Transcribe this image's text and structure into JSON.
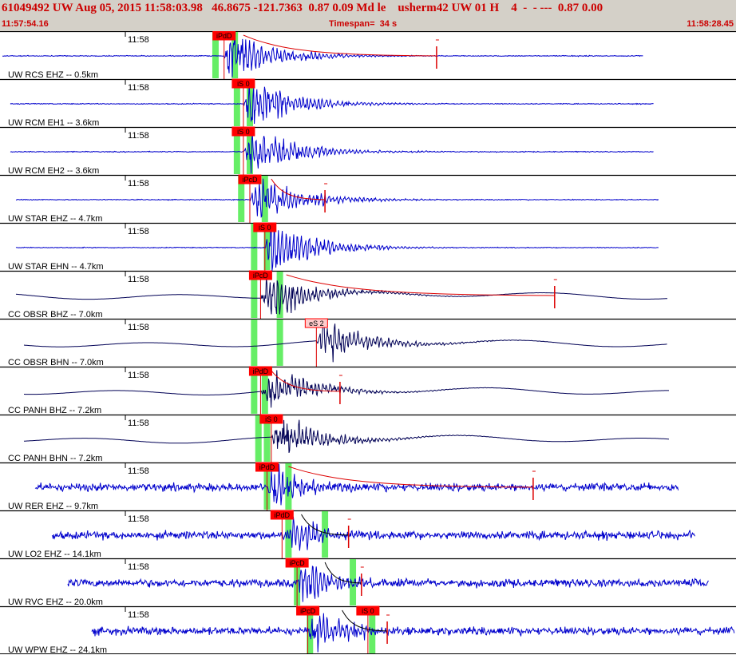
{
  "header": {
    "title": "61049492 UW Aug 05, 2015 11:58:03.98   46.8675 -121.7363  0.87 0.09 Md le    usherm42 UW 01 H    4  -  - ---  0.87 0.00",
    "start_time": "11:57:54.16",
    "timespan": "Timespan=  34 s",
    "end_time": "11:58:28.45"
  },
  "colors": {
    "trace": "#0000cc",
    "trace_dark": "#000055",
    "pick": "#dd0000",
    "pick_box": "#ff0000",
    "window": "#66ee66",
    "background": "#ffffff",
    "header_bg": "#d4d0c8",
    "header_text": "#cc0000"
  },
  "chart_data": {
    "type": "line",
    "title": "",
    "xlabel": "",
    "ylabel": "",
    "x_range": [
      "11:57:54.16",
      "11:58:28.45"
    ],
    "tick_label": "11:58",
    "series": [
      {
        "label": "UW RCS EHZ -- 0.5km",
        "amp": "high",
        "color": "blue",
        "picks": [
          {
            "label": "iPdD",
            "box": "filled",
            "time": "11:58:04.6",
            "windows": [
              "11:58:04.2",
              "11:58:05.1"
            ],
            "coda": [
              "11:58:05.5",
              "11:58:14.5"
            ]
          }
        ]
      },
      {
        "label": "UW RCM EH1 -- 3.6km",
        "amp": "high",
        "color": "blue",
        "picks": [
          {
            "label": "iS 0",
            "box": "filled",
            "time": "11:58:05.5",
            "windows": [
              "11:58:05.2",
              "11:58:05.8"
            ]
          }
        ]
      },
      {
        "label": "UW RCM EH2 -- 3.6km",
        "amp": "high",
        "color": "blue",
        "picks": [
          {
            "label": "iS 0",
            "box": "filled",
            "time": "11:58:05.5",
            "windows": [
              "11:58:05.2",
              "11:58:05.8"
            ]
          }
        ]
      },
      {
        "label": "UW STAR EHZ -- 4.7km",
        "amp": "high",
        "color": "blue",
        "picks": [
          {
            "label": "iPcD",
            "box": "filled",
            "time": "11:58:05.8",
            "windows": [
              "11:58:05.4",
              "11:58:06.5"
            ],
            "coda": [
              "11:58:06.8",
              "11:58:09.3"
            ]
          }
        ]
      },
      {
        "label": "UW STAR EHN -- 4.7km",
        "amp": "high",
        "color": "blue",
        "picks": [
          {
            "label": "iS 0",
            "box": "filled",
            "time": "11:58:06.5",
            "windows": [
              "11:58:06.0",
              "11:58:06.6"
            ]
          }
        ]
      },
      {
        "label": "CC OBSR BHZ -- 7.0km",
        "amp": "medium",
        "color": "dark",
        "picks": [
          {
            "label": "iPcD",
            "box": "filled",
            "time": "11:58:06.3",
            "windows": [
              "11:58:06.0",
              "11:58:07.2"
            ],
            "coda": [
              "11:58:07.5",
              "11:58:20.0"
            ]
          }
        ]
      },
      {
        "label": "CC OBSR BHN -- 7.0km",
        "amp": "medium",
        "color": "dark",
        "picks": [
          {
            "label": "eS 2",
            "box": "outline",
            "time": "11:58:08.9",
            "windows": [
              "11:58:06.0",
              "11:58:07.2"
            ]
          }
        ]
      },
      {
        "label": "CC PANH BHZ -- 7.2km",
        "amp": "medium",
        "color": "dark",
        "picks": [
          {
            "label": "iPdD",
            "box": "filled",
            "time": "11:58:06.3",
            "windows": [
              "11:58:06.0",
              "11:58:06.5"
            ],
            "coda": [
              "11:58:06.8",
              "11:58:10.0"
            ]
          }
        ]
      },
      {
        "label": "CC PANH BHN -- 7.2km",
        "amp": "medium",
        "color": "dark",
        "picks": [
          {
            "label": "iS 0",
            "box": "filled",
            "time": "11:58:06.8",
            "windows": [
              "11:58:06.2",
              "11:58:06.6"
            ]
          }
        ]
      },
      {
        "label": "UW RER EHZ -- 9.7km",
        "amp": "noisy",
        "color": "blue",
        "picks": [
          {
            "label": "iPdD",
            "box": "filled",
            "time": "11:58:06.6",
            "windows": [
              "11:58:06.6",
              "11:58:07.6"
            ],
            "coda": [
              "11:58:07.6",
              "11:58:19.0"
            ]
          }
        ]
      },
      {
        "label": "UW LO2 EHZ -- 14.1km",
        "amp": "noisy",
        "color": "blue",
        "picks": [
          {
            "label": "iPdD",
            "box": "filled",
            "time": "11:58:07.3",
            "windows": [
              "11:58:07.6",
              "11:58:09.3"
            ],
            "coda": [
              "11:58:08.2",
              "11:58:10.4"
            ]
          }
        ]
      },
      {
        "label": "UW RVC EHZ -- 20.0km",
        "amp": "noisy",
        "color": "blue",
        "picks": [
          {
            "label": "iPcD",
            "box": "filled",
            "time": "11:58:08.0",
            "windows": [
              "11:58:08.0",
              "11:58:10.6"
            ],
            "coda": [
              "11:58:09.3",
              "11:58:11.0"
            ]
          }
        ]
      },
      {
        "label": "UW WPW EHZ -- 24.1km",
        "amp": "noisy",
        "color": "blue",
        "picks": [
          {
            "label": "iPcD",
            "box": "filled",
            "time": "11:58:08.5",
            "windows": [
              "11:58:08.6",
              "11:58:11.5"
            ],
            "coda": [
              "11:58:10.1",
              "11:58:12.2"
            ]
          },
          {
            "label": "iS 0",
            "box": "filled",
            "time": "11:58:11.3",
            "windows": []
          }
        ]
      }
    ]
  }
}
